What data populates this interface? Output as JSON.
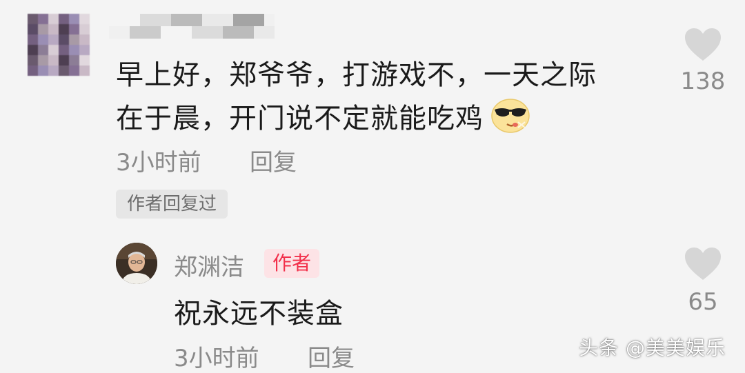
{
  "comment": {
    "text_line1": "早上好，郑爷爷，打游戏不，一天之际",
    "text_line2": "在于晨，开门说不定就能吃鸡",
    "time": "3小时前",
    "reply_label": "回复",
    "like_count": "138",
    "author_replied_tag": "作者回复过",
    "emoji_icon": "sunglasses-smirk-emoji-icon"
  },
  "reply": {
    "user_name": "郑渊洁",
    "badge": "作者",
    "text": "祝永远不装盒",
    "time": "3小时前",
    "reply_label": "回复",
    "like_count": "65"
  },
  "watermark": "头条 @美美娱乐",
  "colors": {
    "background": "#f4f4f4",
    "text_primary": "#1a1a1a",
    "text_secondary": "#8a8a8a",
    "badge_bg": "#fde3e6",
    "badge_text": "#f2304b",
    "heart": "#d6d6d6"
  }
}
